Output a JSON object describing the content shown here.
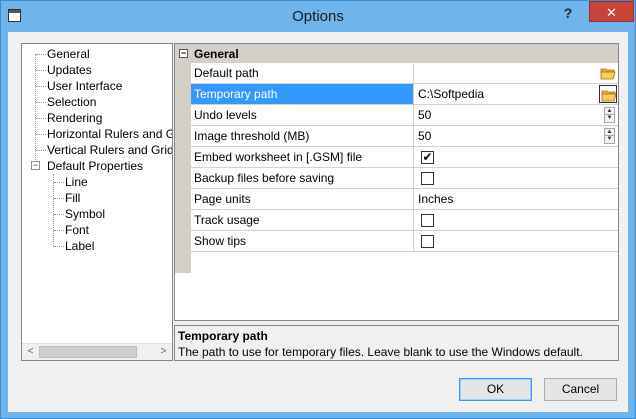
{
  "window": {
    "title": "Options",
    "help_label": "?",
    "close_label": "✕"
  },
  "tree": {
    "items": [
      {
        "label": "General",
        "selected": true
      },
      {
        "label": "Updates"
      },
      {
        "label": "User Interface"
      },
      {
        "label": "Selection"
      },
      {
        "label": "Rendering"
      },
      {
        "label": "Horizontal Rulers and Gri"
      },
      {
        "label": "Vertical Rulers and Grid"
      },
      {
        "label": "Default Properties",
        "expanded": true
      },
      {
        "label": "Line",
        "child": true
      },
      {
        "label": "Fill",
        "child": true
      },
      {
        "label": "Symbol",
        "child": true
      },
      {
        "label": "Font",
        "child": true
      },
      {
        "label": "Label",
        "child": true
      }
    ],
    "expander_symbol": "−",
    "scroll_left": "<",
    "scroll_right": ">"
  },
  "grid": {
    "category": "General",
    "collapse_symbol": "−",
    "rows": [
      {
        "name": "Default path",
        "value": "",
        "editor": "folder"
      },
      {
        "name": "Temporary path",
        "value": "C:\\Softpedia",
        "editor": "folder",
        "selected": true
      },
      {
        "name": "Undo levels",
        "value": "50",
        "editor": "spin"
      },
      {
        "name": "Image threshold (MB)",
        "value": "50",
        "editor": "spin"
      },
      {
        "name": "Embed worksheet in [.GSM] file",
        "value": "",
        "editor": "check",
        "checked": true
      },
      {
        "name": "Backup files before saving",
        "value": "",
        "editor": "check",
        "checked": false
      },
      {
        "name": "Page units",
        "value": "Inches",
        "editor": "text"
      },
      {
        "name": "Track usage",
        "value": "",
        "editor": "check",
        "checked": false
      },
      {
        "name": "Show tips",
        "value": "",
        "editor": "check",
        "checked": false
      }
    ],
    "check_mark": "✔",
    "spin_up": "▲",
    "spin_down": "▼"
  },
  "description": {
    "title": "Temporary path",
    "text": "The path to use for temporary files.  Leave blank to use the Windows default."
  },
  "buttons": {
    "ok_label": "OK",
    "cancel_label": "Cancel"
  },
  "colors": {
    "title_bar": "#6fb4ea",
    "selection": "#3399ff",
    "close_button": "#c7443a"
  },
  "icons": {
    "app": "application-icon",
    "folder": "folder-open-icon"
  }
}
